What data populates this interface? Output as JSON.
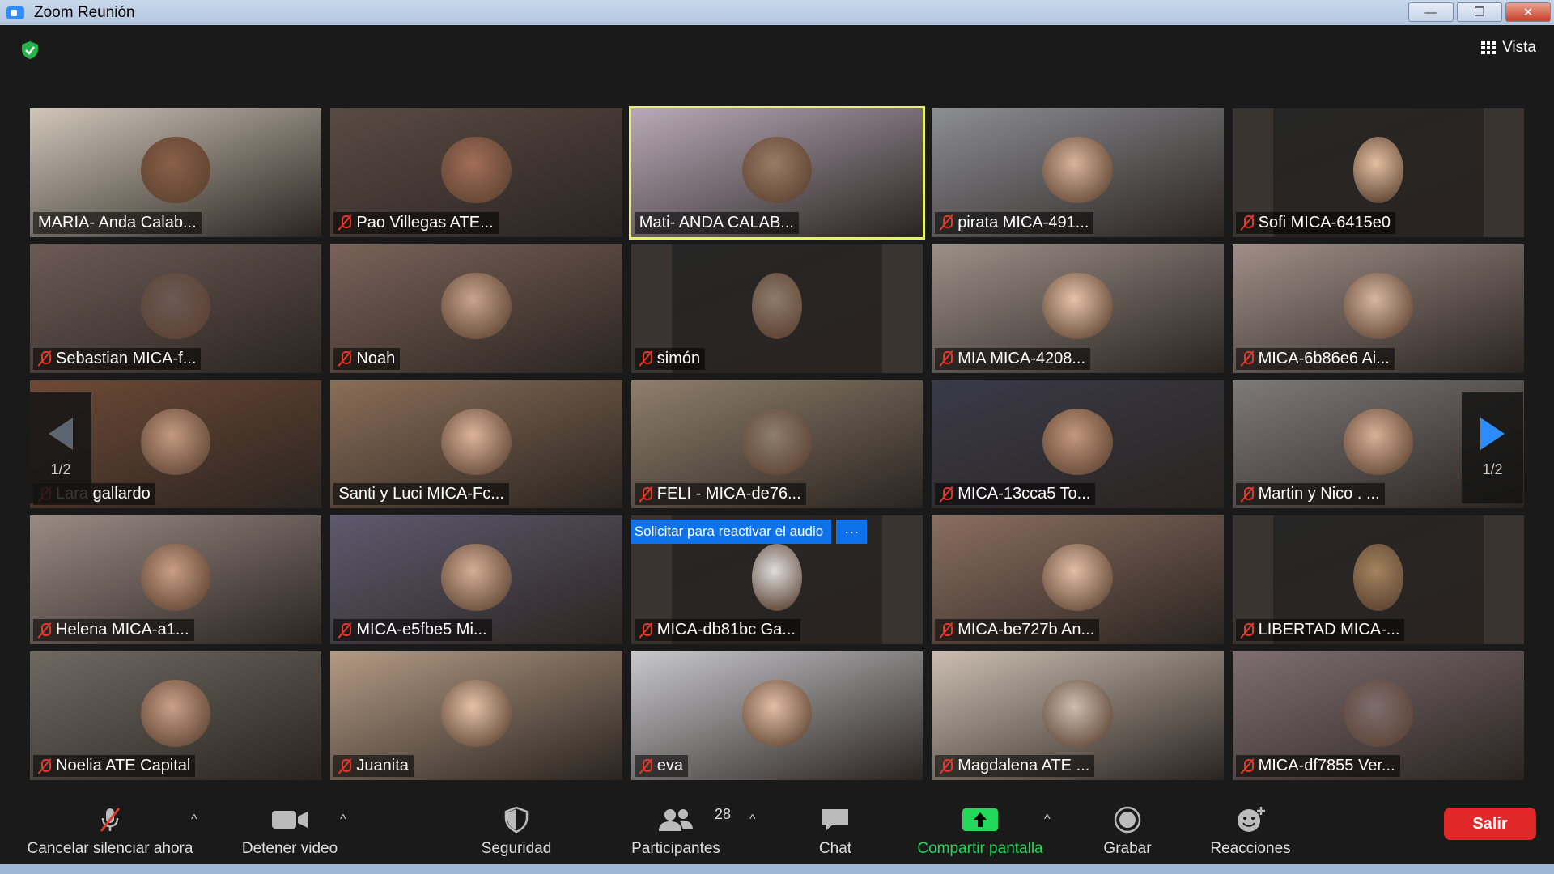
{
  "window": {
    "title": "Zoom Reunión",
    "minimize": "—",
    "restore": "❐",
    "close": "✕"
  },
  "top": {
    "view_label": "Vista"
  },
  "pager": {
    "left": "1/2",
    "right": "1/2"
  },
  "unmute_banner": {
    "text": "Solicitar para reactivar el audio",
    "more": "···"
  },
  "participants": [
    {
      "name": "MARIA- Anda Calab...",
      "muted": false,
      "bg": "#cfc6b8",
      "face": "#8a6048"
    },
    {
      "name": "Pao Villegas ATE...",
      "muted": true,
      "bg": "#5a4a44",
      "face": "#a26e58"
    },
    {
      "name": "Mati- ANDA CALAB...",
      "muted": false,
      "bg": "#b7a9b8",
      "face": "#9a7b66",
      "active": true
    },
    {
      "name": "pirata MICA-491...",
      "muted": true,
      "bg": "#8d8e93",
      "face": "#d8b49a"
    },
    {
      "name": "Sofi MICA-6415e0",
      "muted": true,
      "bg": "#262626",
      "face": "#e2bfa0",
      "inset": true
    },
    {
      "name": "Sebastian MICA-f...",
      "muted": true,
      "bg": "#6c5a55",
      "face": "#6c5a55"
    },
    {
      "name": "Noah",
      "muted": true,
      "bg": "#7a6258",
      "face": "#c8a48c"
    },
    {
      "name": "simón",
      "muted": true,
      "bg": "#262626",
      "face": "#8f7c6a",
      "inset": true
    },
    {
      "name": "MIA   MICA-4208...",
      "muted": true,
      "bg": "#9c8f88",
      "face": "#e6c3a8"
    },
    {
      "name": "MICA-6b86e6  Ai...",
      "muted": true,
      "bg": "#a08e88",
      "face": "#d7b6a0"
    },
    {
      "name": "Lara gallardo",
      "muted": true,
      "bg": "#6e4a36",
      "face": "#c49a80"
    },
    {
      "name": "Santi y Luci MICA-Fc...",
      "muted": false,
      "bg": "#8a6e58",
      "face": "#dcb49a"
    },
    {
      "name": "FELI - MICA-de76...",
      "muted": true,
      "bg": "#8e7e6c",
      "face": "#8e7e6c"
    },
    {
      "name": "MICA-13cca5 To...",
      "muted": true,
      "bg": "#3a3a48",
      "face": "#c4987c"
    },
    {
      "name": "Martin y Nico . ...",
      "muted": true,
      "bg": "#7e7a78",
      "face": "#d8b096"
    },
    {
      "name": "Helena  MICA-a1...",
      "muted": true,
      "bg": "#9a8a84",
      "face": "#c99e84"
    },
    {
      "name": "MICA-e5fbe5  Mi...",
      "muted": true,
      "bg": "#5e5a6e",
      "face": "#d4ae94"
    },
    {
      "name": "MICA-db81bc Ga...",
      "muted": true,
      "bg": "#262626",
      "face": "#ddd",
      "inset": true,
      "unmute": true
    },
    {
      "name": "MICA-be727b An...",
      "muted": true,
      "bg": "#8a6e60",
      "face": "#e2bea4"
    },
    {
      "name": "LIBERTAD MICA-...",
      "muted": true,
      "bg": "#262626",
      "face": "#a4845e",
      "inset": true
    },
    {
      "name": "Noelia ATE Capital",
      "muted": true,
      "bg": "#6e6a62",
      "face": "#caa088"
    },
    {
      "name": "Juanita",
      "muted": true,
      "bg": "#b39a84",
      "face": "#e4c2a6"
    },
    {
      "name": "eva",
      "muted": true,
      "bg": "#c8c8cc",
      "face": "#e2bea4"
    },
    {
      "name": "Magdalena ATE ...",
      "muted": true,
      "bg": "#cbbdb0",
      "face": "#cbbdb0"
    },
    {
      "name": "MICA-df7855 Ver...",
      "muted": true,
      "bg": "#7e6e70",
      "face": "#7e6e70"
    }
  ],
  "toolbar": {
    "unmute": "Cancelar silenciar ahora",
    "stop_video": "Detener video",
    "security": "Seguridad",
    "participants": "Participantes",
    "participant_count": "28",
    "chat": "Chat",
    "share_screen": "Compartir pantalla",
    "record": "Grabar",
    "reactions": "Reacciones",
    "leave": "Salir",
    "caret": "^"
  },
  "colors": {
    "accent": "#2d8cff",
    "share": "#23d959",
    "leave": "#e02828",
    "active_speaker": "#e6f36a",
    "mute": "#e0382b"
  }
}
